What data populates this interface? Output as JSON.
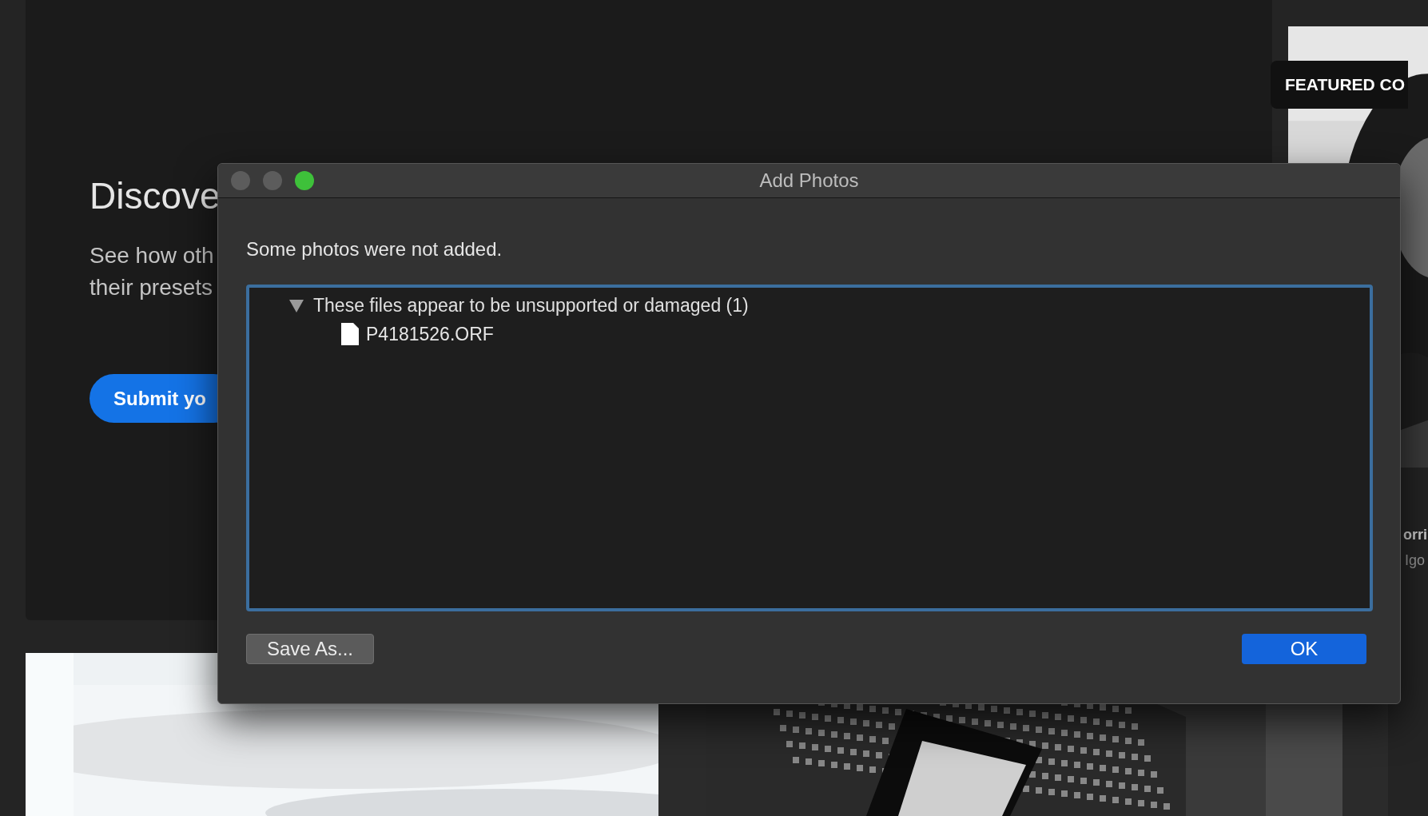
{
  "background": {
    "hero": {
      "title": "Discove",
      "body_lines": [
        "See how oth",
        "their presets"
      ],
      "button": "Submit yo"
    },
    "featured": {
      "badge": "FEATURED CO",
      "name": "orri",
      "subtitle": "Igo"
    }
  },
  "dialog": {
    "title": "Add Photos",
    "window_controls": [
      {
        "color": "#5c5c5c"
      },
      {
        "color": "#5c5c5c"
      },
      {
        "color": "#3ec13a"
      }
    ],
    "message": "Some photos were not added.",
    "tree": [
      {
        "label": "These files appear to be unsupported or damaged (1)",
        "expanded": true,
        "children": [
          {
            "label": "P4181526.ORF"
          }
        ]
      }
    ],
    "buttons": [
      {
        "label": "Save As...",
        "kind": "secondary"
      },
      {
        "label": "OK",
        "kind": "default"
      }
    ]
  }
}
